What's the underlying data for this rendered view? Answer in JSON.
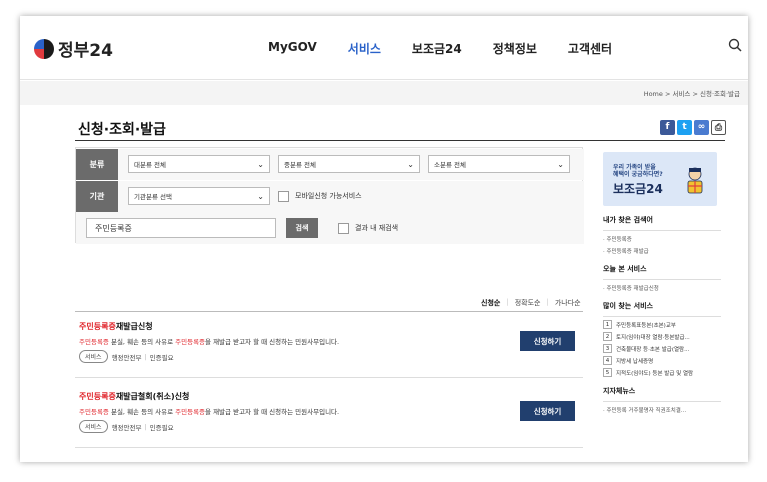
{
  "header": {
    "logo_text": "정부24",
    "nav": [
      "MyGOV",
      "서비스",
      "보조금24",
      "정책정보",
      "고객센터"
    ],
    "active_nav": "서비스"
  },
  "breadcrumb": "Home > 서비스 > 신청·조회·발급",
  "page_title": "신청·조회·발급",
  "filters": {
    "category_label": "분류",
    "category_major": "대분류 전체",
    "category_middle": "중분류 전체",
    "category_minor": "소분류 전체",
    "agency_label": "기관",
    "agency_select": "기관분류 선택",
    "mobile_checkbox_label": "모바일신청 가능서비스",
    "keyword_value": "주민등록증",
    "search_button": "검색",
    "within_results_label": "결과 내 재검색"
  },
  "sort": {
    "options": [
      "신청순",
      "정확도순",
      "가나다순"
    ],
    "selected": "신청순"
  },
  "results": [
    {
      "title_hl": "주민등록증",
      "title_rest": "재발급신청",
      "desc_pre": "",
      "desc_hl1": "주민등록증",
      "desc_mid": " 분실, 훼손 등의 사유로 ",
      "desc_hl2": "주민등록증",
      "desc_post": "을 재발급 받고자 할 때 신청하는 민원사무입니다.",
      "tag": "서비스",
      "agency": "행정안전부",
      "auth": "인증필요",
      "button": "신청하기"
    },
    {
      "title_hl": "주민등록증",
      "title_rest": "재발급철회(취소)신청",
      "desc_pre": "",
      "desc_hl1": "주민등록증",
      "desc_mid": " 분실, 훼손 등의 사유로 ",
      "desc_hl2": "주민등록증",
      "desc_post": "을 재발급 받고자 할 때 신청하는 민원사무입니다.",
      "tag": "서비스",
      "agency": "행정안전부",
      "auth": "인증필요",
      "button": "신청하기"
    }
  ],
  "sidebar": {
    "banner_line1": "우리 가족이 받을",
    "banner_line2": "혜택이 궁금하다면?",
    "banner_line3": "보조금24",
    "recent_search_title": "내가 찾은 검색어",
    "recent_searches": [
      "· 주민등록증",
      "· 주민등록증 재발급"
    ],
    "viewed_title": "오늘 본 서비스",
    "viewed": [
      "· 주민등록증 재발급신청"
    ],
    "popular_title": "많이 찾는 서비스",
    "popular": [
      {
        "num": "1",
        "label": "주민등록표등본(초본)교부"
      },
      {
        "num": "2",
        "label": "토지(임야)대장 열람·등본발급..."
      },
      {
        "num": "3",
        "label": "건축물대장 등·초본 발급(열람..."
      },
      {
        "num": "4",
        "label": "지방세 납세증명"
      },
      {
        "num": "5",
        "label": "지적도(임야도) 등본 발급 및 열람"
      }
    ],
    "local_news_title": "지자체뉴스",
    "local_news": [
      "· 주민등록 거주불명자 직권조치결..."
    ]
  },
  "colors": {
    "accent_blue": "#2a62c9",
    "apply_button": "#213f6e",
    "highlight_red": "#e0262c",
    "filter_label_bg": "#6b6b6b"
  }
}
